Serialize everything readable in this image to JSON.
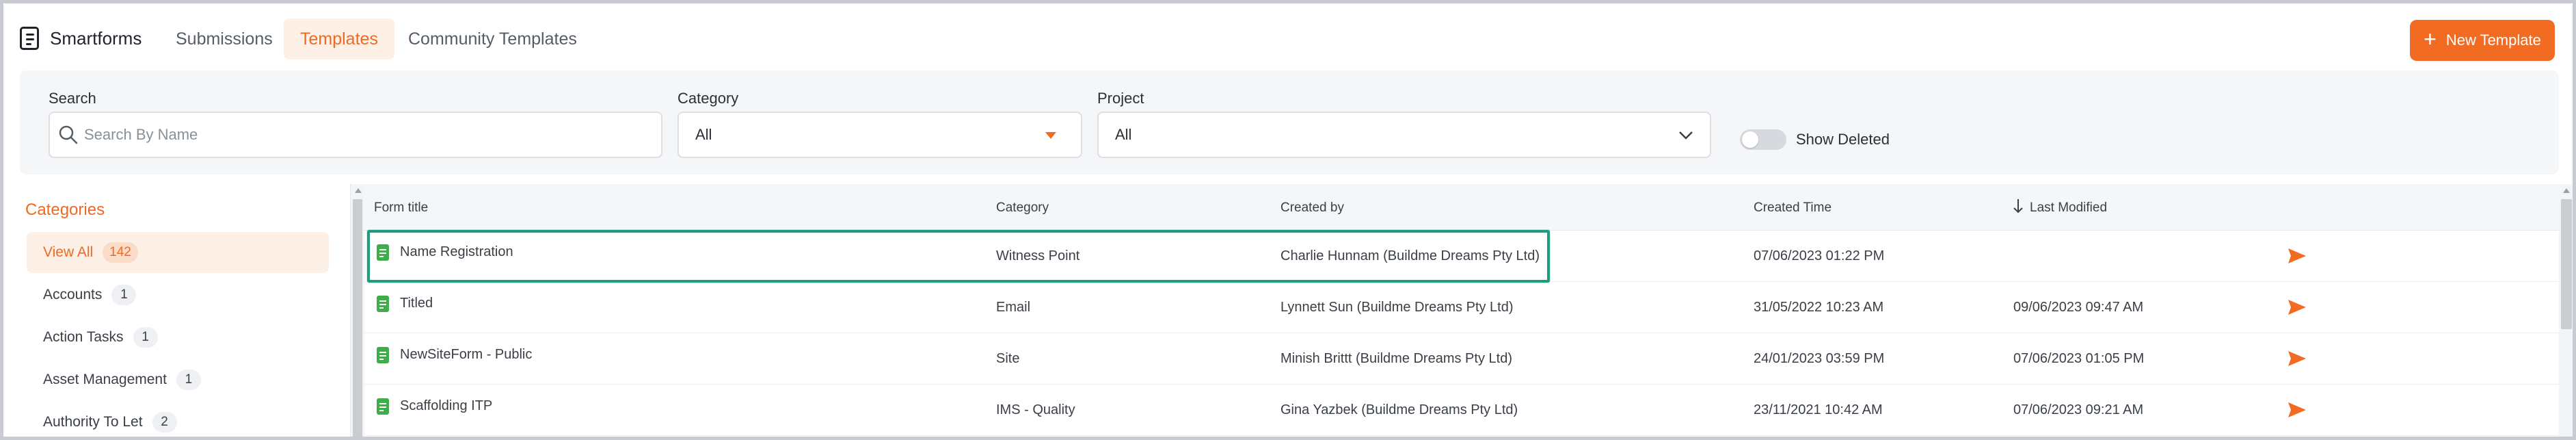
{
  "app": {
    "name": "Smartforms"
  },
  "nav": {
    "tabs": [
      {
        "label": "Submissions"
      },
      {
        "label": "Templates"
      },
      {
        "label": "Community Templates"
      }
    ],
    "new_button": "New Template"
  },
  "filters": {
    "search": {
      "label": "Search",
      "placeholder": "Search By Name"
    },
    "category": {
      "label": "Category",
      "value": "All"
    },
    "project": {
      "label": "Project",
      "value": "All"
    },
    "show_deleted": {
      "label": "Show Deleted",
      "on": false
    }
  },
  "sidebar": {
    "title": "Categories",
    "items": [
      {
        "label": "View All",
        "count": "142"
      },
      {
        "label": "Accounts",
        "count": "1"
      },
      {
        "label": "Action Tasks",
        "count": "1"
      },
      {
        "label": "Asset Management",
        "count": "1"
      },
      {
        "label": "Authority To Let",
        "count": "2"
      }
    ]
  },
  "table": {
    "columns": [
      "Form title",
      "Category",
      "Created by",
      "Created Time",
      "Last Modified"
    ],
    "rows": [
      {
        "title": "Name Registration",
        "category": "Witness Point",
        "created_by": "Charlie Hunnam (Buildme Dreams Pty Ltd)",
        "created_time": "07/06/2023 01:22 PM",
        "last_modified": ""
      },
      {
        "title": "Titled",
        "category": "Email",
        "created_by": "Lynnett Sun (Buildme Dreams Pty Ltd)",
        "created_time": "31/05/2022 10:23 AM",
        "last_modified": "09/06/2023 09:47 AM"
      },
      {
        "title": "NewSiteForm - Public",
        "category": "Site",
        "created_by": "Minish Brittt (Buildme Dreams Pty Ltd)",
        "created_time": "24/01/2023 03:59 PM",
        "last_modified": "07/06/2023 01:05 PM"
      },
      {
        "title": "Scaffolding ITP",
        "category": "IMS - Quality",
        "created_by": "Gina Yazbek (Buildme Dreams Pty Ltd)",
        "created_time": "23/11/2021 10:42 AM",
        "last_modified": "07/06/2023 09:21 AM"
      }
    ]
  },
  "colors": {
    "accent": "#f26b22",
    "highlight": "#1f9c7f",
    "form_icon": "#3fae4a"
  }
}
